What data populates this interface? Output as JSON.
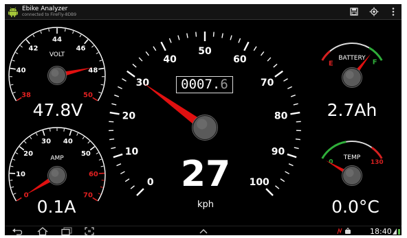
{
  "app": {
    "title": "Ebike Analyzer",
    "subtitle": "connected to FireFly-8DB9",
    "actions": [
      {
        "name": "save-button",
        "icon": "save-icon"
      },
      {
        "name": "locate-button",
        "icon": "location-target-icon"
      },
      {
        "name": "overflow-menu-button",
        "icon": "overflow-menu-icon"
      }
    ]
  },
  "gauges": {
    "volt": {
      "label": "VOLT",
      "readout": "47.8V",
      "ticks": [
        "38",
        "40",
        "42",
        "44",
        "46",
        "48",
        "50"
      ],
      "red_ticks": [
        "38",
        "50"
      ],
      "range": [
        38,
        50
      ],
      "value": 47.8
    },
    "amp": {
      "label": "AMP",
      "readout": "0.1A",
      "ticks": [
        "0",
        "10",
        "20",
        "30",
        "40",
        "50",
        "60",
        "70"
      ],
      "red_ticks": [
        "0",
        "60",
        "70"
      ],
      "range": [
        0,
        70
      ],
      "value": 0.1
    },
    "speed": {
      "unit": "kph",
      "readout": "27",
      "odometer_int": "0007.",
      "odometer_frac": "6",
      "ticks": [
        "0",
        "10",
        "20",
        "30",
        "40",
        "50",
        "60",
        "70",
        "80",
        "90",
        "100"
      ],
      "range": [
        0,
        100
      ],
      "value": 30
    },
    "battery": {
      "label": "BATTERY",
      "readout": "2.7Ah",
      "low_mark": "E",
      "high_mark": "F",
      "value": 0.82
    },
    "temp": {
      "label": "TEMP",
      "readout": "0.0°C",
      "low_mark": "0",
      "high_mark": "130",
      "range": [
        0,
        130
      ],
      "value": 0
    }
  },
  "colors": {
    "needle": "#e01010",
    "red_tick": "#e02020",
    "green_arc": "#2fae3a",
    "red_arc": "#d42020",
    "background": "#000000"
  },
  "status": {
    "time": "18:40"
  },
  "nav": [
    "back-icon",
    "home-icon",
    "recent-apps-icon",
    "screenshot-icon",
    "chevron-up-icon"
  ]
}
